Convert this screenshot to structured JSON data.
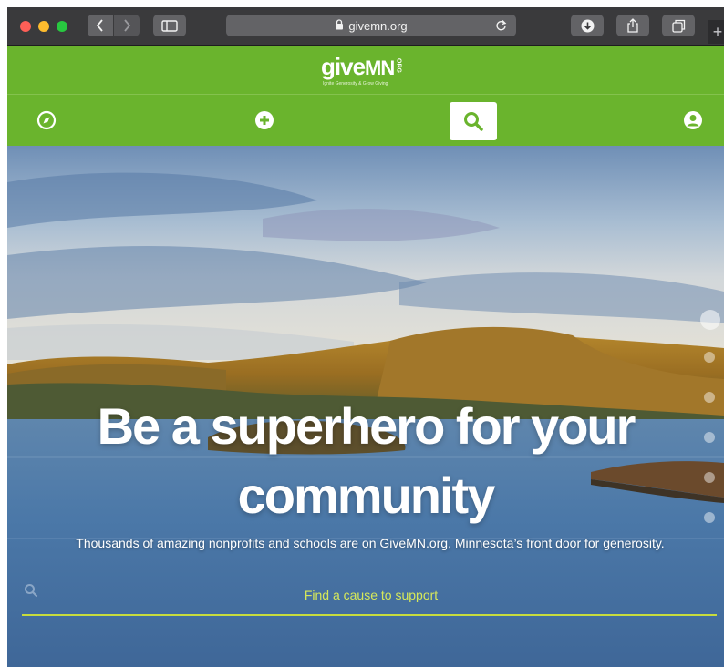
{
  "browser": {
    "url": "givemn.org",
    "newtab_label": "+"
  },
  "site": {
    "logo": {
      "give": "give",
      "mn": "MN",
      "org": "ORG",
      "tagline": "Ignite Generosity & Grow Giving"
    }
  },
  "hero": {
    "headline_line1": "Be a superhero for your",
    "headline_line2": "community",
    "subline": "Thousands of amazing nonprofits and schools are on GiveMN.org, Minnesota’s front door for generosity.",
    "search_placeholder": "Find a cause to support"
  },
  "colors": {
    "brand_green": "#6ab42d",
    "search_underline": "#c8dc3c",
    "search_text": "#d6e85a"
  },
  "icons": {
    "nav": [
      "compass-icon",
      "plus-circle-icon",
      "search-icon",
      "user-icon"
    ]
  }
}
